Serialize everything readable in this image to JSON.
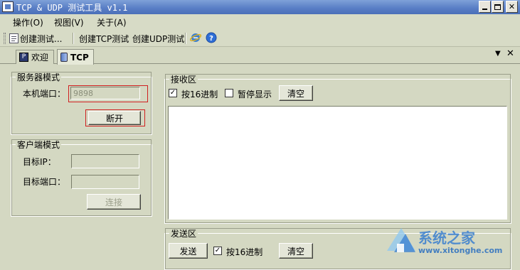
{
  "titlebar": {
    "title": "TCP & UDP 测试工具 v1.1",
    "minimize_icon": "minimize-icon",
    "maximize_icon": "maximize-icon",
    "close_icon": "close-icon"
  },
  "menu": {
    "items": [
      {
        "label": "操作(O)"
      },
      {
        "label": "视图(V)"
      },
      {
        "label": "关于(A)"
      }
    ]
  },
  "toolbar": {
    "create_test_label": "创建测试...",
    "create_tcp_label": "创建TCP测试",
    "create_udp_label": "创建UDP测试",
    "ie_icon": "ie-icon",
    "help_icon": "help-icon"
  },
  "tabs": [
    {
      "label": "欢迎",
      "active": false
    },
    {
      "label": "TCP",
      "active": true
    }
  ],
  "server": {
    "group_label": "服务器模式",
    "port_label": "本机端口：",
    "port_value": "9898",
    "disconnect_label": "断开"
  },
  "client": {
    "group_label": "客户端模式",
    "target_ip_label": "目标IP：",
    "target_ip_value": "",
    "target_port_label": "目标端口：",
    "target_port_value": "",
    "connect_label": "连接"
  },
  "receive": {
    "group_label": "接收区",
    "hex_label": "按16进制",
    "hex_checked": true,
    "pause_label": "暂停显示",
    "pause_checked": false,
    "clear_label": "清空",
    "content": ""
  },
  "send": {
    "group_label": "发送区",
    "send_label": "发送",
    "hex_label": "按16进制",
    "hex_checked": true,
    "clear_label": "清空"
  },
  "watermark": {
    "title": "系统之家",
    "url": "www.xitonghe.com"
  },
  "colors": {
    "titlebar": "#5a7fc6",
    "window_bg": "#d4d8c2",
    "highlight_box": "#d02020",
    "watermark": "#3a7fd0"
  }
}
